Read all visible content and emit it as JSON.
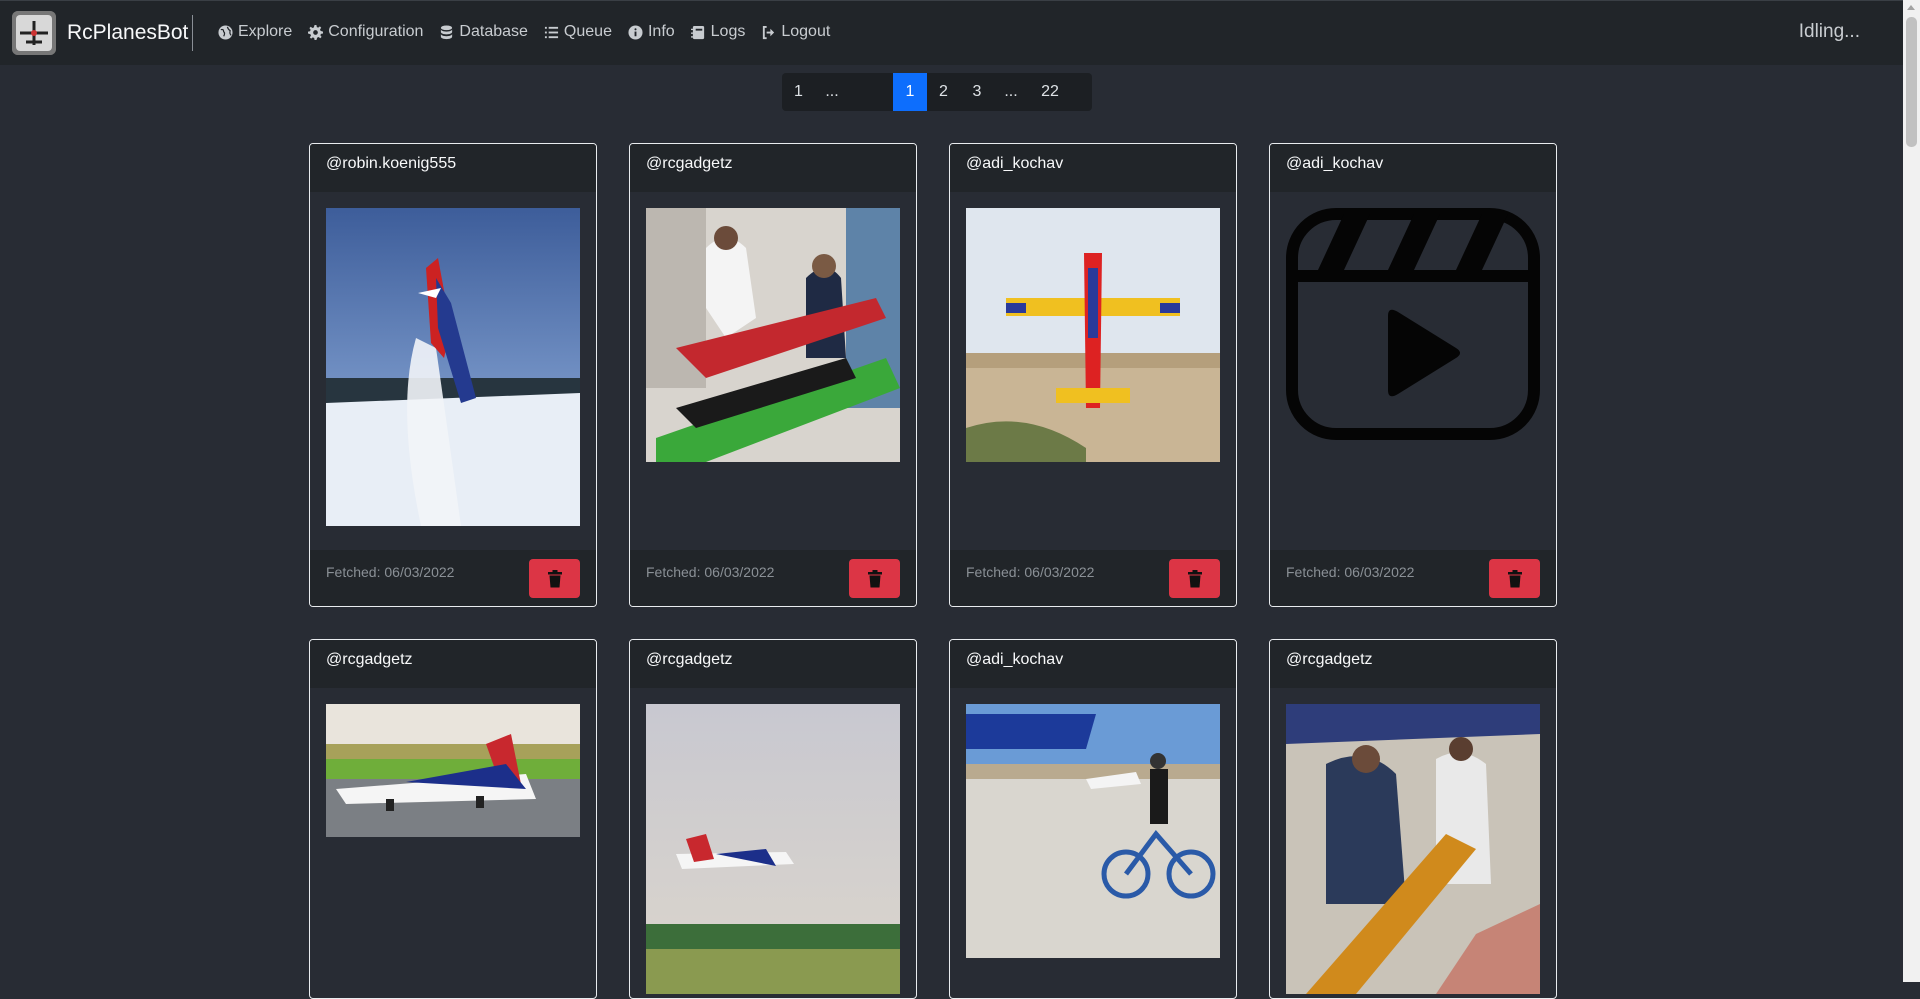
{
  "brand": {
    "name": "RcPlanesBot",
    "logo_icon": "rc-plane-logo-icon"
  },
  "nav": {
    "items": [
      {
        "label": "Explore",
        "icon": "globe-icon"
      },
      {
        "label": "Configuration",
        "icon": "gear-icon"
      },
      {
        "label": "Database",
        "icon": "database-icon"
      },
      {
        "label": "Queue",
        "icon": "list-icon"
      },
      {
        "label": "Info",
        "icon": "info-circle-icon"
      },
      {
        "label": "Logs",
        "icon": "notebook-icon"
      },
      {
        "label": "Logout",
        "icon": "logout-icon"
      }
    ]
  },
  "status": "Idling...",
  "pagination": {
    "items": [
      "1",
      "...",
      "1",
      "2",
      "3",
      "...",
      "22"
    ],
    "active": "1"
  },
  "colors": {
    "accent": "#0d6efd",
    "danger": "#dc3545",
    "background": "#282c34",
    "navbar": "#212529"
  },
  "cards": [
    {
      "user": "@robin.koenig555",
      "fetched": "Fetched: 06/03/2022",
      "media": "photo",
      "subject": "red-white-blue plane climbing vertically over snowy field"
    },
    {
      "user": "@rcgadgetz",
      "fetched": "Fetched: 06/03/2022",
      "media": "photo",
      "subject": "people in hobby shop with green and red jet models"
    },
    {
      "user": "@adi_kochav",
      "fetched": "Fetched: 06/03/2022",
      "media": "photo",
      "subject": "yellow-red aerobatic plane hovering over desert"
    },
    {
      "user": "@adi_kochav",
      "fetched": "Fetched: 06/03/2022",
      "media": "video-placeholder",
      "subject": "video clapperboard play icon"
    },
    {
      "user": "@rcgadgetz",
      "media": "photo",
      "subject": "F-16 jet model on runway"
    },
    {
      "user": "@rcgadgetz",
      "media": "photo",
      "subject": "F-16 jet model flying low"
    },
    {
      "user": "@adi_kochav",
      "media": "photo",
      "subject": "boy with bicycle at airfield"
    },
    {
      "user": "@rcgadgetz",
      "media": "photo",
      "subject": "men working on yellow jet model under tent"
    }
  ]
}
